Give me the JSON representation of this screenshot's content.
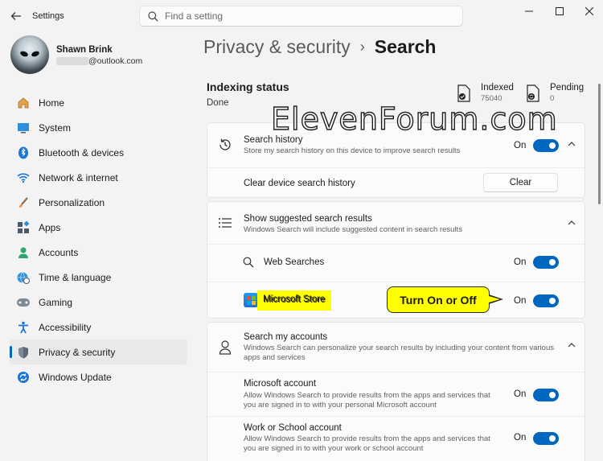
{
  "app": {
    "title": "Settings"
  },
  "search": {
    "placeholder": "Find a setting"
  },
  "user": {
    "name": "Shawn Brink",
    "email_visible": "@outlook.com"
  },
  "sidebar": {
    "items": [
      {
        "label": "Home",
        "icon": "home-icon"
      },
      {
        "label": "System",
        "icon": "system-icon"
      },
      {
        "label": "Bluetooth & devices",
        "icon": "bluetooth-icon"
      },
      {
        "label": "Network & internet",
        "icon": "wifi-icon"
      },
      {
        "label": "Personalization",
        "icon": "brush-icon"
      },
      {
        "label": "Apps",
        "icon": "apps-icon"
      },
      {
        "label": "Accounts",
        "icon": "accounts-icon"
      },
      {
        "label": "Time & language",
        "icon": "globe-clock-icon"
      },
      {
        "label": "Gaming",
        "icon": "gamepad-icon"
      },
      {
        "label": "Accessibility",
        "icon": "accessibility-icon"
      },
      {
        "label": "Privacy & security",
        "icon": "shield-icon",
        "active": true
      },
      {
        "label": "Windows Update",
        "icon": "update-icon"
      }
    ]
  },
  "breadcrumb": {
    "parent": "Privacy & security",
    "current": "Search"
  },
  "indexing": {
    "title": "Indexing status",
    "status": "Done",
    "indexed_label": "Indexed",
    "indexed_count": "75040",
    "pending_label": "Pending",
    "pending_count": "0"
  },
  "watermark": "ElevenForum.com",
  "search_history": {
    "title": "Search history",
    "desc": "Store my search history on this device to improve search results",
    "state": "On",
    "clear_label": "Clear device search history",
    "clear_button": "Clear"
  },
  "suggested": {
    "title": "Show suggested search results",
    "desc": "Windows Search will include suggested content in search results",
    "web_label": "Web Searches",
    "web_state": "On",
    "store_label": "Microsoft Store",
    "store_state": "On"
  },
  "callout": "Turn On or Off",
  "accounts": {
    "title": "Search my accounts",
    "desc_line1": "Windows Search can personalize your search results by including your content from various",
    "desc_line2": "apps and services",
    "ms_title": "Microsoft account",
    "ms_desc_line1": "Allow Windows Search to provide results from the apps and services that",
    "ms_desc_line2": "you are signed in to with your personal Microsoft account",
    "ms_state": "On",
    "work_title": "Work or School account",
    "work_desc_line1": "Allow Windows Search to provide results from the apps and services that",
    "work_desc_line2": "you are signed in to with your work or school account",
    "work_state": "On"
  },
  "colors": {
    "accent": "#0067c0",
    "highlight": "#ffff00"
  }
}
